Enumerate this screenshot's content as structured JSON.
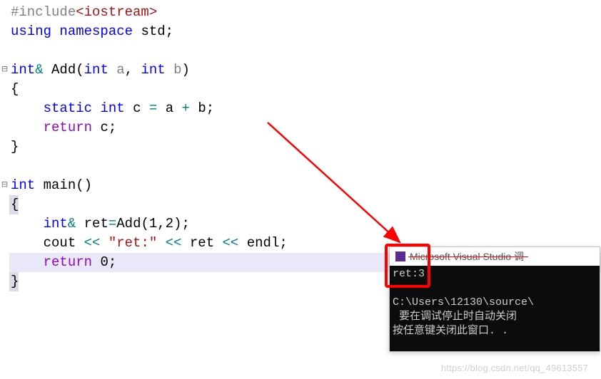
{
  "code": {
    "l1_preproc": "#include",
    "l1_header": "<iostream>",
    "l2_using": "using",
    "l2_ns": "namespace",
    "l2_std": "std",
    "l4_ret": "int",
    "l4_amp": "&",
    "l4_func": "Add",
    "l4_p1t": "int",
    "l4_p1n": "a",
    "l4_p2t": "int",
    "l4_p2n": "b",
    "l6_static": "static",
    "l6_int": "int",
    "l6_c": "c",
    "l6_eq": "=",
    "l6_a": "a",
    "l6_plus": "+",
    "l6_b": "b",
    "l7_return": "return",
    "l7_c": "c",
    "l10_int": "int",
    "l10_main": "main",
    "l12_int": "int",
    "l12_amp": "&",
    "l12_ret": "ret",
    "l12_eq": "=",
    "l12_add": "Add",
    "l12_arg1": "1",
    "l12_arg2": "2",
    "l13_cout": "cout",
    "l13_lshift": "<<",
    "l13_str": "\"ret:\"",
    "l13_retv": "ret",
    "l13_endl": "endl",
    "l14_return": "return",
    "l14_zero": "0"
  },
  "console": {
    "title": "Microsoft Visual Studio 调",
    "output": "ret:3",
    "path": "C:\\Users\\12130\\source\\",
    "msg1": " 要在调试停止时自动关闭",
    "msg2": "按任意键关闭此窗口. .",
    "icon_name": "vs-icon"
  },
  "watermark": "https://blog.csdn.net/qq_49613557"
}
